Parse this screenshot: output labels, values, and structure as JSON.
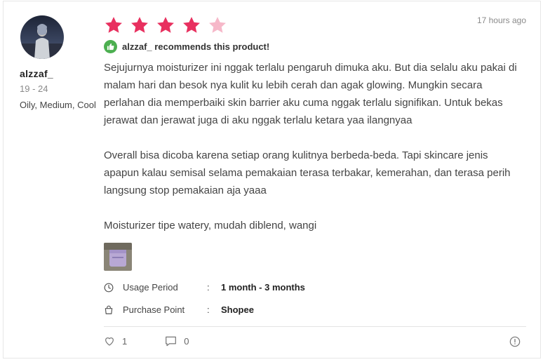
{
  "reviewer": {
    "username": "alzzaf_",
    "age_range": "19 - 24",
    "skin_profile": "Oily, Medium, Cool"
  },
  "rating": {
    "value": 4,
    "max": 5
  },
  "timestamp": "17 hours ago",
  "recommend_text": "alzzaf_ recommends this product!",
  "review": {
    "paragraph_1": "Sejujurnya moisturizer ini nggak terlalu pengaruh dimuka aku. But dia selalu aku pakai di malam hari dan besok nya kulit ku lebih cerah dan agak glowing. Mungkin secara perlahan dia memperbaiki skin barrier aku cuma nggak terlalu signifikan. Untuk bekas jerawat dan jerawat juga di aku nggak terlalu ketara yaa ilangnyaa",
    "paragraph_2": "Overall bisa dicoba karena setiap orang kulitnya berbeda-beda. Tapi skincare jenis apapun kalau semisal selama pemakaian terasa terbakar, kemerahan, dan terasa perih langsung stop pemakaian aja yaaa",
    "paragraph_3": "Moisturizer tipe watery, mudah diblend, wangi"
  },
  "usage": {
    "label": "Usage Period",
    "separator": ":",
    "value": "1 month - 3 months"
  },
  "purchase": {
    "label": "Purchase Point",
    "separator": ":",
    "value": "Shopee"
  },
  "actions": {
    "likes": "1",
    "comments": "0"
  },
  "colors": {
    "star_filled": "#e8305f",
    "star_empty": "#f6b8c9",
    "recommend_badge": "#4caf50"
  },
  "icons": [
    "avatar-photo",
    "star-icon",
    "thumbs-up-icon",
    "clock-icon",
    "shopping-bag-icon",
    "heart-icon",
    "comment-icon",
    "report-icon"
  ]
}
